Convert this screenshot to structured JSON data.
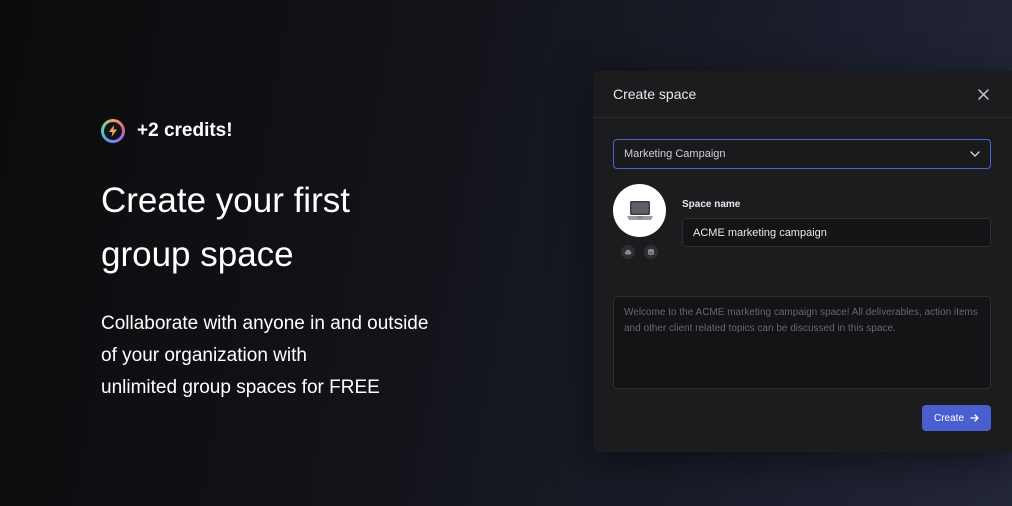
{
  "promo": {
    "credits": "+2 credits!",
    "headline": "Create your first group space",
    "subline": [
      "Collaborate with anyone in and outside",
      "of your organization with",
      "unlimited group spaces for FREE"
    ]
  },
  "modal": {
    "title": "Create space",
    "template_select": {
      "value": "Marketing Campaign"
    },
    "space_name": {
      "label": "Space name",
      "value": "ACME marketing campaign"
    },
    "description": {
      "placeholder": "Welcome to the ACME marketing campaign space! All deliverables, action items and other client related topics can be discussed in this space."
    },
    "create_label": "Create"
  },
  "icons": {
    "credits": "bolt-ring-icon",
    "close": "close-icon",
    "select": "chevron-down-icon",
    "avatar": "laptop-icon",
    "upload": "cloud-upload-icon",
    "emoji": "emoji-icon",
    "create": "arrow-right-icon"
  },
  "colors": {
    "accent": "#4a5fcf",
    "focus_border": "#4d64d6",
    "modal_bg": "#1c1c1f"
  }
}
